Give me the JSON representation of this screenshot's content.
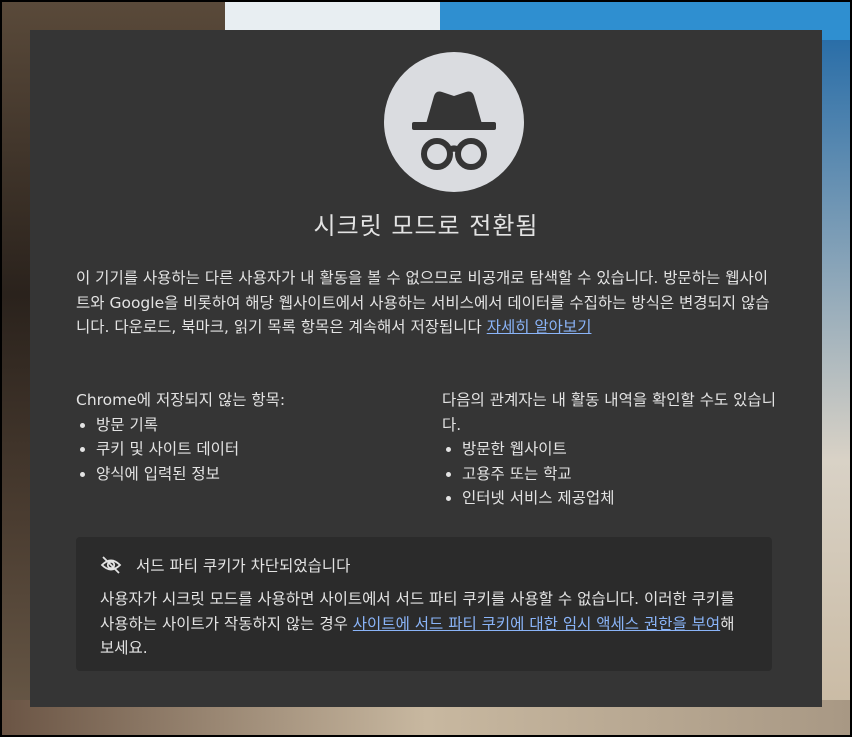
{
  "window": {
    "title": "시크릿 모드로 전환됨"
  },
  "intro": {
    "text": "이 기기를 사용하는 다른 사용자가 내 활동을 볼 수 없으므로 비공개로 탐색할 수 있습니다. 방문하는 웹사이트와 Google을 비롯하여 해당 웹사이트에서 사용하는 서비스에서 데이터를 수집하는 방식은 변경되지 않습니다. 다운로드, 북마크, 읽기 목록 항목은 계속해서 저장됩니다 ",
    "link": "자세히 알아보기"
  },
  "not_saved": {
    "heading": "Chrome에 저장되지 않는 항목:",
    "items": [
      "방문 기록",
      "쿠키 및 사이트 데이터",
      "양식에 입력된 정보"
    ]
  },
  "visible_to": {
    "heading": "다음의 관계자는 내 활동 내역을 확인할 수도 있습니다.",
    "items": [
      "방문한 웹사이트",
      "고용주 또는 학교",
      "인터넷 서비스 제공업체"
    ]
  },
  "cookie_notice": {
    "icon": "eye-off-icon",
    "heading": "서드 파티 쿠키가 차단되었습니다",
    "body_before": "사용자가 시크릿 모드를 사용하면 사이트에서 서드 파티 쿠키를 사용할 수 없습니다. 이러한 쿠키를 사용하는 사이트가 작동하지 않는 경우 ",
    "link": "사이트에 서드 파티 쿠키에 대한 임시 액세스 권한을 부여",
    "body_after": "해 보세요."
  },
  "colors": {
    "panel_bg": "#353535",
    "notice_bg": "#2b2b2b",
    "text": "#e3e3e3",
    "link": "#8ab4f8",
    "icon_circle": "#dadce0",
    "icon_fg": "#353535"
  }
}
